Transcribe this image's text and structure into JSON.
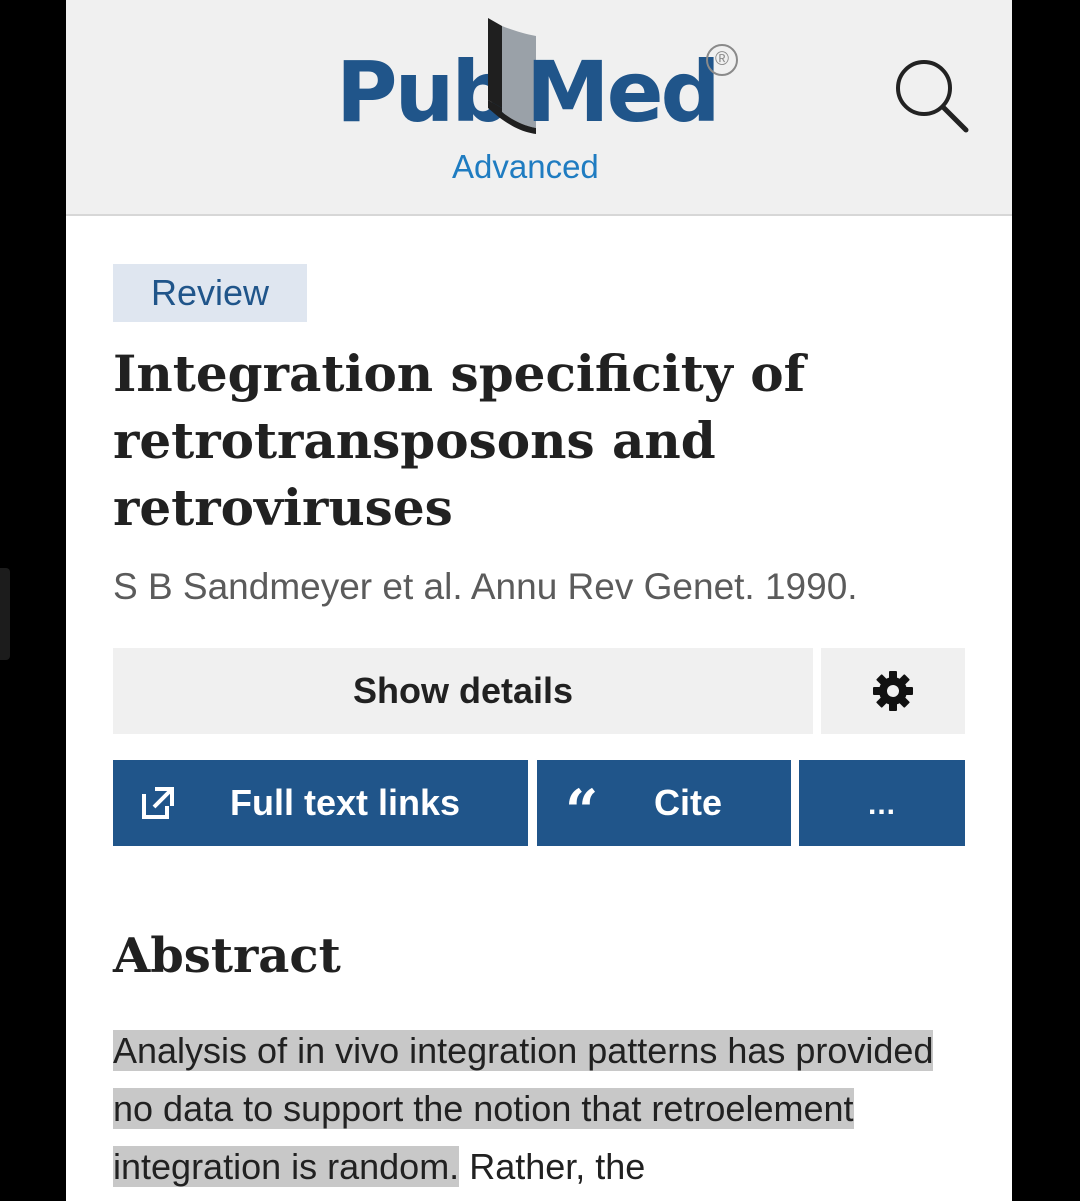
{
  "header": {
    "logo_pub": "Pub",
    "logo_med": "Med",
    "logo_registered": "®",
    "subtitle": "Advanced",
    "search_icon": "search-icon"
  },
  "article": {
    "badge": "Review",
    "title": "Integration specificity of retrotransposons and retroviruses",
    "citation": "S B Sandmeyer et al. Annu Rev Genet. 1990."
  },
  "actions": {
    "show_details": "Show details",
    "settings_icon": "gear-icon",
    "full_text_links": "Full text links",
    "full_text_icon": "external-link-icon",
    "cite": "Cite",
    "cite_icon": "quote-icon",
    "more": "..."
  },
  "abstract": {
    "heading": "Abstract",
    "text_highlighted": "Analysis of in vivo integration patterns has provided no data to support the notion that retroelement integration is random.",
    "text_rest": "Rather, the"
  },
  "colors": {
    "brand_blue": "#20558a",
    "link_blue": "#1f7cc1",
    "highlight": "#c8c8c8",
    "header_bg": "#f0f0f0"
  }
}
